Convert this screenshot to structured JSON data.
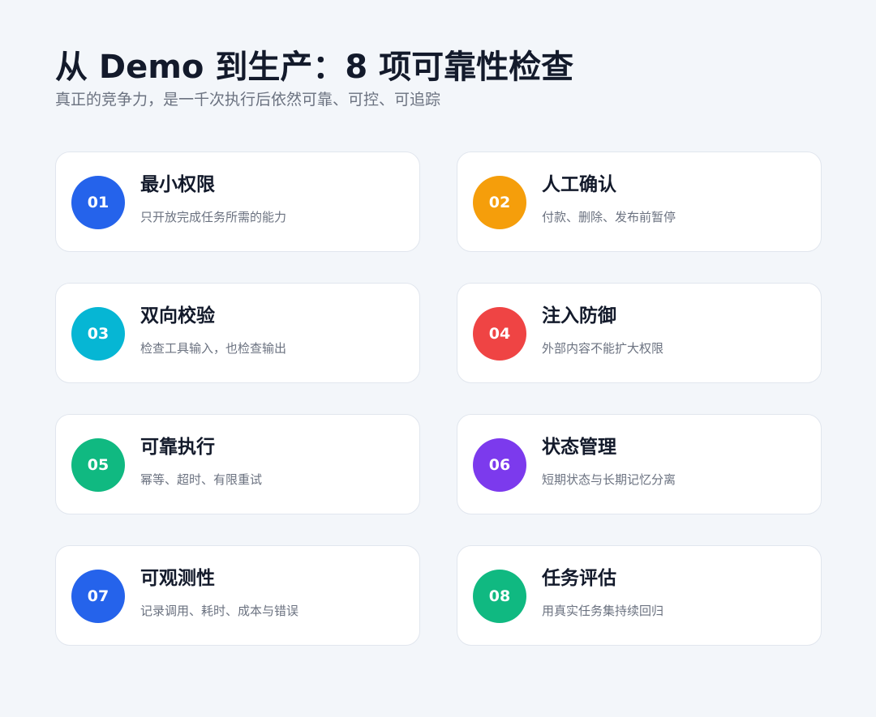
{
  "header": {
    "title": "从 Demo 到生产：8 项可靠性检查",
    "subtitle": "真正的竞争力，是一千次执行后依然可靠、可控、可追踪"
  },
  "cards": [
    {
      "number": "01",
      "title": "最小权限",
      "description": "只开放完成任务所需的能力",
      "color": "#2563eb"
    },
    {
      "number": "02",
      "title": "人工确认",
      "description": "付款、删除、发布前暂停",
      "color": "#f59e0b"
    },
    {
      "number": "03",
      "title": "双向校验",
      "description": "检查工具输入，也检查输出",
      "color": "#06b6d4"
    },
    {
      "number": "04",
      "title": "注入防御",
      "description": "外部内容不能扩大权限",
      "color": "#ef4444"
    },
    {
      "number": "05",
      "title": "可靠执行",
      "description": "幂等、超时、有限重试",
      "color": "#10b981"
    },
    {
      "number": "06",
      "title": "状态管理",
      "description": "短期状态与长期记忆分离",
      "color": "#7c3aed"
    },
    {
      "number": "07",
      "title": "可观测性",
      "description": "记录调用、耗时、成本与错误",
      "color": "#2563eb"
    },
    {
      "number": "08",
      "title": "任务评估",
      "description": "用真实任务集持续回归",
      "color": "#10b981"
    }
  ]
}
